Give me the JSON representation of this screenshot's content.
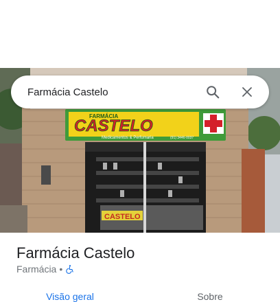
{
  "search": {
    "query": "Farmácia Castelo"
  },
  "photo": {
    "sign_line1": "FARMÁCIA",
    "sign_main": "CASTELO",
    "sign_sub": "Medicamentos & Perfumaria",
    "sign_phone": "(91) 3446-0037",
    "counter_text": "CASTELO"
  },
  "place": {
    "title": "Farmácia Castelo",
    "category": "Farmácia",
    "separator": "•"
  },
  "tabs": [
    {
      "label": "Visão geral"
    },
    {
      "label": "Sobre"
    }
  ],
  "colors": {
    "accent": "#1a73e8",
    "sign_green": "#3f9b3a",
    "sign_yellow": "#f2d21a"
  },
  "icons": [
    "search-icon",
    "close-icon",
    "wheelchair-icon"
  ]
}
